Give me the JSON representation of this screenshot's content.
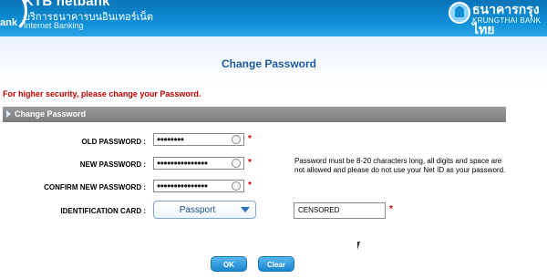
{
  "header": {
    "brand_partial": "ank",
    "app_title": "KTB netbank",
    "app_thai": "บริการธนาคารบนอินเทอร์เน็ต",
    "app_sub": "Internet Banking",
    "bank_thai": "ธนาคารกรุงไทย",
    "bank_en": "KRUNGTHAI BANK"
  },
  "page": {
    "title": "Change Password",
    "warning": "For higher security, please change your Password.",
    "section_title": "Change Password"
  },
  "form": {
    "old_password": {
      "label": "OLD PASSWORD :",
      "value": "••••••••"
    },
    "new_password": {
      "label": "NEW PASSWORD :",
      "value": "•••••••••••••••"
    },
    "confirm_password": {
      "label": "CONFIRM NEW PASSWORD :",
      "value": "•••••••••••••••"
    },
    "id_card": {
      "label": "IDENTIFICATION CARD :",
      "selected": "Passport",
      "value": "CENSORED"
    },
    "required_mark": "*",
    "hint": "Password must be 8-20 characters long, all digits and space are not allowed and please do not use your Net ID as your password."
  },
  "buttons": {
    "ok": "OK",
    "clear": "Clear"
  },
  "colors": {
    "header_blue": "#0e8fd6",
    "title_blue": "#1f5aa0",
    "warning_red": "#c00000",
    "section_gray": "#8a8a8a"
  }
}
